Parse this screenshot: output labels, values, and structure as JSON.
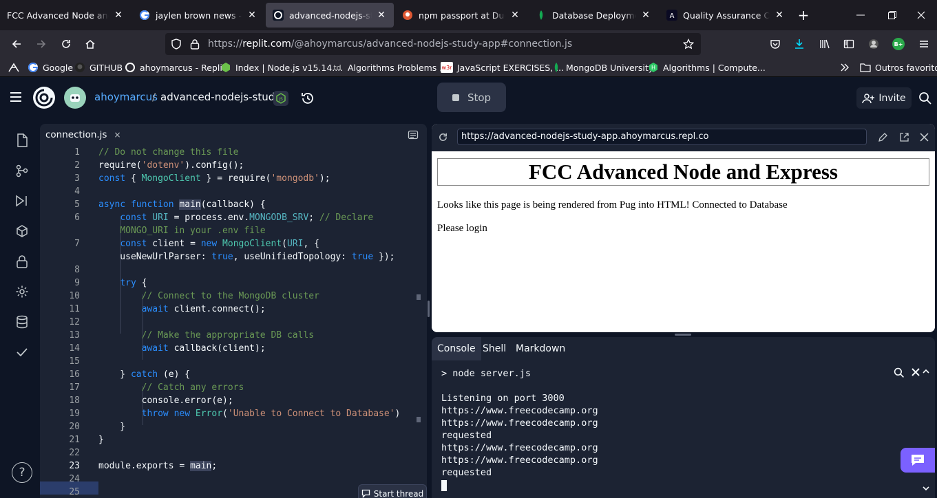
{
  "browser": {
    "tabs": [
      {
        "title": "FCC Advanced Node and Exp",
        "icon": "fcc-icon",
        "active": false
      },
      {
        "title": "jaylen brown news - Pesqu",
        "icon": "google-icon",
        "active": false
      },
      {
        "title": "advanced-nodejs-study-a",
        "icon": "replit-icon",
        "active": true
      },
      {
        "title": "npm passport at DuckDuc",
        "icon": "duckduckgo-icon",
        "active": false
      },
      {
        "title": "Database Deployments | A",
        "icon": "mongodb-leaf-icon",
        "active": false
      },
      {
        "title": "Quality Assurance Certific",
        "icon": "fcc-logo-icon",
        "active": false
      }
    ],
    "close_glyph": "✕",
    "new_tab_glyph": "+",
    "url": {
      "prefix": "https://",
      "host": "replit.com",
      "path": "/@ahoymarcus/advanced-nodejs-study-app#connection.js"
    },
    "bookmarks": [
      {
        "label": "Google",
        "icon": "google-icon"
      },
      {
        "label": "GITHUB",
        "icon": "github-icon"
      },
      {
        "label": "ahoymarcus - Replit",
        "icon": "replit-icon"
      },
      {
        "label": "Index | Node.js v15.14....",
        "icon": "nodejs-icon"
      },
      {
        "label": "Algorithms Problems ...",
        "icon": "td-icon"
      },
      {
        "label": "JavaScript EXERCISES, ...",
        "icon": "w3r-icon"
      },
      {
        "label": "MongoDB University",
        "icon": "mongodb-leaf-icon"
      },
      {
        "label": "Algorithms | Compute...",
        "icon": "hackerrank-icon"
      }
    ],
    "other_bookmarks": "Outros favoritos",
    "td_glyph": "td",
    "w3r_glyph": "w3r",
    "profile_badge": "B+"
  },
  "replit": {
    "user": "ahoymarcus",
    "separator": "/",
    "repl_name": "advanced-nodejs-stud...",
    "stop_label": "Stop",
    "invite_label": "Invite",
    "help_glyph": "?"
  },
  "editor": {
    "tab_name": "connection.js",
    "tab_close": "×",
    "line_numbers": [
      "1",
      "2",
      "3",
      "4",
      "5",
      "6",
      "7",
      "8",
      "9",
      "10",
      "11",
      "12",
      "13",
      "14",
      "15",
      "16",
      "17",
      "18",
      "19",
      "20",
      "21",
      "22",
      "23",
      "24",
      "25"
    ],
    "start_thread_label": "Start thread"
  },
  "webview": {
    "url": "https://advanced-nodejs-study-app.ahoymarcus.repl.co",
    "heading": "FCC Advanced Node and Express",
    "para1": "Looks like this page is being rendered from Pug into HTML! Connected to Database",
    "para2": "Please login"
  },
  "console": {
    "tabs": [
      "Console",
      "Shell",
      "Markdown"
    ],
    "lines": [
      "> node server.js",
      "",
      "Listening on port 3000",
      "https://www.freecodecamp.org",
      "https://www.freecodecamp.org",
      "requested",
      "https://www.freecodecamp.org",
      "https://www.freecodecamp.org",
      "requested"
    ]
  },
  "colors": {
    "replit_bg": "#0e1525",
    "panel_bg": "#1c2333",
    "accent_blue": "#0079f2",
    "chat_purple": "#7b61ff"
  }
}
